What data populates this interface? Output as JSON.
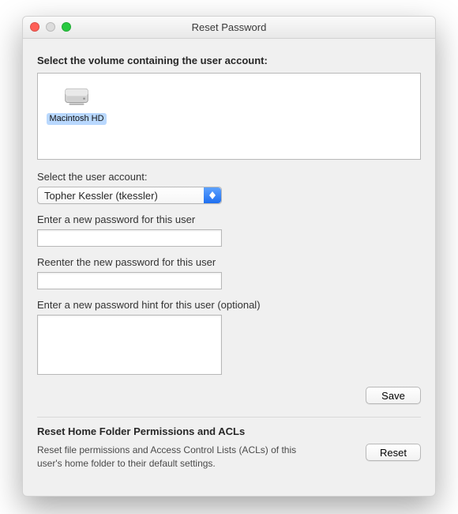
{
  "window": {
    "title": "Reset Password"
  },
  "volume_section": {
    "heading": "Select the volume containing the user account:",
    "items": [
      {
        "label": "Macintosh HD",
        "selected": true
      }
    ]
  },
  "user_section": {
    "label": "Select the user account:",
    "selected": "Topher Kessler (tkessler)"
  },
  "password_section": {
    "new_label": "Enter a new password for this user",
    "new_value": "",
    "reenter_label": "Reenter the new password for this user",
    "reenter_value": "",
    "hint_label": "Enter a new password hint for this user (optional)",
    "hint_value": ""
  },
  "buttons": {
    "save": "Save",
    "reset": "Reset"
  },
  "acl_section": {
    "heading": "Reset Home Folder Permissions and ACLs",
    "description": "Reset file permissions and Access Control Lists (ACLs) of this user's home folder to their default settings."
  }
}
